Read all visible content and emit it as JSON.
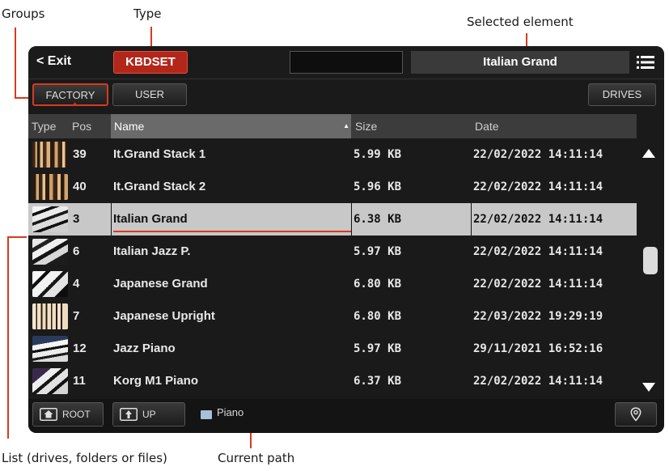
{
  "callouts": {
    "groups": "Groups",
    "type": "Type",
    "selected_element": "Selected element",
    "list": "List (drives, folders or files)",
    "current_path": "Current path"
  },
  "topbar": {
    "exit_label": "< Exit",
    "type_label": "KBDSET",
    "selected_name": "Italian Grand",
    "menu_icon": "hamburger-menu-icon"
  },
  "groups": {
    "factory_label": "FACTORY",
    "user_label": "USER",
    "drives_label": "DRIVES"
  },
  "table": {
    "headers": {
      "type": "Type",
      "pos": "Pos",
      "name": "Name",
      "size": "Size",
      "date": "Date"
    },
    "rows": [
      {
        "pos": "39",
        "name": "It.Grand Stack 1",
        "size": "5.99 KB",
        "date": "22/02/2022 14:11:14",
        "selected": false
      },
      {
        "pos": "40",
        "name": "It.Grand Stack 2",
        "size": "5.96 KB",
        "date": "22/02/2022 14:11:14",
        "selected": false
      },
      {
        "pos": "3",
        "name": "Italian Grand",
        "size": "6.38 KB",
        "date": "22/02/2022 14:11:14",
        "selected": true
      },
      {
        "pos": "6",
        "name": "Italian Jazz P.",
        "size": "5.97 KB",
        "date": "22/02/2022 14:11:14",
        "selected": false
      },
      {
        "pos": "4",
        "name": "Japanese Grand",
        "size": "6.80 KB",
        "date": "22/02/2022 14:11:14",
        "selected": false
      },
      {
        "pos": "7",
        "name": "Japanese Upright",
        "size": "6.80 KB",
        "date": "22/03/2022 19:29:19",
        "selected": false
      },
      {
        "pos": "12",
        "name": "Jazz Piano",
        "size": "5.97 KB",
        "date": "29/11/2021 16:52:16",
        "selected": false
      },
      {
        "pos": "11",
        "name": "Korg M1 Piano",
        "size": "6.37 KB",
        "date": "22/02/2022 14:11:14",
        "selected": false
      }
    ]
  },
  "bottombar": {
    "root_label": "ROOT",
    "up_label": "UP",
    "path": "Piano"
  },
  "colors": {
    "accent": "#d83a1e",
    "type_button": "#b3261a",
    "selected_row": "#c8c8c8",
    "background": "#1a1a1a"
  }
}
